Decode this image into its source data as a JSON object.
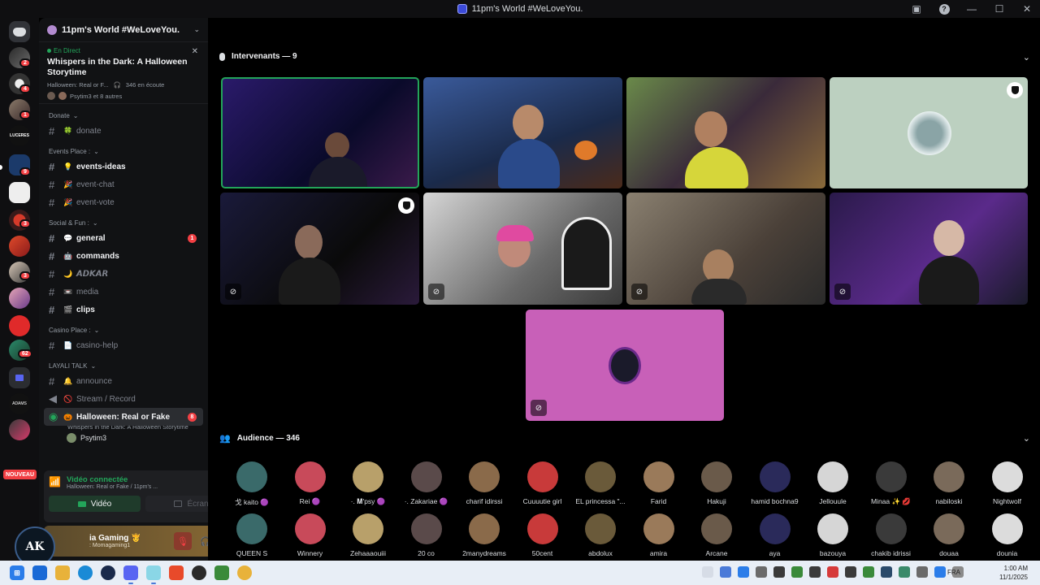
{
  "window": {
    "title": "11pm's World #WeLoveYou."
  },
  "rail": {
    "badges": [
      "2",
      "4",
      "1",
      "9",
      "3",
      "3",
      "62"
    ],
    "new_label": "NOUVEAU",
    "server_text": [
      "LUCERES",
      "ADAMS"
    ]
  },
  "sidebar": {
    "server_name": "11pm's World #WeLoveYou.",
    "stage": {
      "live_label": "En Direct",
      "title": "Whispers in the Dark: A Halloween Storytime",
      "channel": "Halloween: Real or F...",
      "listeners": "346 en écoute",
      "speakers": "Psytim3 et 8 autres"
    },
    "items": [
      {
        "kind": "cat",
        "label": "Donate"
      },
      {
        "kind": "ch",
        "emoji": "🍀",
        "label": "donate",
        "bright": false
      },
      {
        "kind": "cat",
        "label": "Events Place :"
      },
      {
        "kind": "ch",
        "emoji": "💡",
        "label": "events-ideas",
        "bright": true
      },
      {
        "kind": "ch",
        "emoji": "🎉",
        "label": "event-chat",
        "bright": false
      },
      {
        "kind": "ch",
        "emoji": "🎉",
        "label": "event-vote",
        "bright": false
      },
      {
        "kind": "cat",
        "label": "Social & Fun :"
      },
      {
        "kind": "ch",
        "emoji": "💬",
        "label": "general",
        "bright": true,
        "badge": "1"
      },
      {
        "kind": "ch",
        "emoji": "🤖",
        "label": "commands",
        "bright": true
      },
      {
        "kind": "ch",
        "emoji": "🌙",
        "label": "𝘼𝘿𝙆𝘼𝙍",
        "bright": false
      },
      {
        "kind": "ch",
        "emoji": "📼",
        "label": "media",
        "bright": false
      },
      {
        "kind": "ch",
        "emoji": "🎬",
        "label": "clips",
        "bright": true
      },
      {
        "kind": "cat",
        "label": "Casino Place :"
      },
      {
        "kind": "ch",
        "emoji": "📄",
        "label": "casino-help",
        "bright": false
      },
      {
        "kind": "cat",
        "label": "LAYALI TALK"
      },
      {
        "kind": "ch",
        "emoji": "🔔",
        "label": "announce",
        "bright": false
      },
      {
        "kind": "voice",
        "emoji": "🚫",
        "label": "Stream / Record",
        "bright": false
      }
    ],
    "active_stage": {
      "label": "Halloween: Real or Fake",
      "badge": "8",
      "subtitle": "Whispers in the Dark: A Halloween Storytime",
      "user": "Psytim3"
    },
    "voice_panel": {
      "title": "Vidéo connectée",
      "subtitle": "Halloween: Real or Fake / 11pm's ...",
      "video_label": "Vidéo",
      "screen_label": "Écran"
    },
    "user_panel": {
      "name": "ia Gaming 🫅",
      "sub": ": Momagaming1",
      "avatar_text": "AK"
    }
  },
  "stage_main": {
    "speakers_label": "Intervenants — 9",
    "audience_label": "Audience — 346"
  },
  "audience": [
    "戈 kaito 🟣",
    "Rei 🟣",
    "·. 𝐌'psy 🟣",
    "·. Zakariae 🟣",
    "charif idirssi",
    "Cuuuutie girl",
    "EL princessa \"...",
    "Farid",
    "Hakuji",
    "hamid bochna9",
    "Jellouule",
    "Minaa ✨ 💋",
    "nabiloski",
    "Nightwolf",
    "QUEEN S",
    "Winnery",
    "Zehaaaouiii",
    "20 co",
    "2manydreams",
    "50cent",
    "abdolux",
    "amira",
    "Arcane",
    "aya",
    "bazouya",
    "chakib idrissi",
    "douaa",
    "dounia"
  ],
  "taskbar": {
    "lang": "FRA",
    "time": "1:00 AM",
    "date": "11/1/2025"
  },
  "colors": {
    "accent_green": "#23a55a",
    "badge_red": "#f23f43",
    "sidebar_bg": "#111214",
    "stage_bg": "#000000"
  }
}
